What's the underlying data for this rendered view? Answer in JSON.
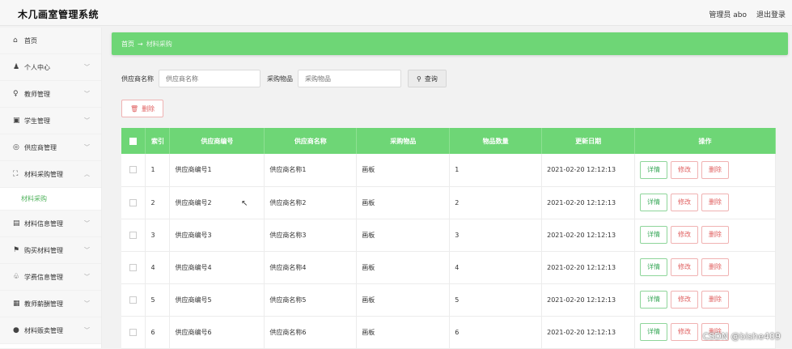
{
  "app": {
    "title": "木几画室管理系统"
  },
  "topbar": {
    "user": "管理员 abo",
    "logout": "退出登录"
  },
  "sidebar": {
    "items": [
      {
        "icon": "home-icon",
        "glyph": "⌂",
        "label": "首页",
        "chevron": false
      },
      {
        "icon": "user-icon",
        "glyph": "♟",
        "label": "个人中心",
        "chevron": true
      },
      {
        "icon": "teacher-icon",
        "glyph": "♀",
        "label": "教师管理",
        "chevron": true
      },
      {
        "icon": "student-icon",
        "glyph": "▣",
        "label": "学生管理",
        "chevron": true
      },
      {
        "icon": "supplier-icon",
        "glyph": "◎",
        "label": "供应商管理",
        "chevron": true
      },
      {
        "icon": "purchase-icon",
        "glyph": "⛶",
        "label": "材料采购管理",
        "chevron": true,
        "expanded": true
      },
      {
        "icon": "material-info-icon",
        "glyph": "▤",
        "label": "材料信息管理",
        "chevron": true
      },
      {
        "icon": "flag-icon",
        "glyph": "⚑",
        "label": "购买材料管理",
        "chevron": true
      },
      {
        "icon": "fee-icon",
        "glyph": "♧",
        "label": "学费信息管理",
        "chevron": true
      },
      {
        "icon": "salary-icon",
        "glyph": "▦",
        "label": "教师薪酬管理",
        "chevron": true
      },
      {
        "icon": "sale-icon",
        "glyph": "●",
        "label": "材料贩卖管理",
        "chevron": true
      }
    ],
    "sub_item": "材料采购"
  },
  "breadcrumb": {
    "home": "首页",
    "arrow": "→",
    "current": "材料采购"
  },
  "filters": {
    "supplier_label": "供应商名称",
    "supplier_placeholder": "供应商名称",
    "item_label": "采购物品",
    "item_placeholder": "采购物品",
    "query_label": "查询"
  },
  "toolbar": {
    "delete_label": "删除"
  },
  "table": {
    "headers": [
      "索引",
      "供应商编号",
      "供应商名称",
      "采购物品",
      "物品数量",
      "更新日期",
      "操作"
    ],
    "rows": [
      {
        "index": "1",
        "supplier_no": "供应商编号1",
        "supplier_name": "供应商名称1",
        "item": "画板",
        "qty": "1",
        "date": "2021-02-20 12:12:13"
      },
      {
        "index": "2",
        "supplier_no": "供应商编号2",
        "supplier_name": "供应商名称2",
        "item": "画板",
        "qty": "2",
        "date": "2021-02-20 12:12:13"
      },
      {
        "index": "3",
        "supplier_no": "供应商编号3",
        "supplier_name": "供应商名称3",
        "item": "画板",
        "qty": "3",
        "date": "2021-02-20 12:12:13"
      },
      {
        "index": "4",
        "supplier_no": "供应商编号4",
        "supplier_name": "供应商名称4",
        "item": "画板",
        "qty": "4",
        "date": "2021-02-20 12:12:13"
      },
      {
        "index": "5",
        "supplier_no": "供应商编号5",
        "supplier_name": "供应商名称5",
        "item": "画板",
        "qty": "5",
        "date": "2021-02-20 12:12:13"
      },
      {
        "index": "6",
        "supplier_no": "供应商编号6",
        "supplier_name": "供应商名称6",
        "item": "画板",
        "qty": "6",
        "date": "2021-02-20 12:12:13"
      }
    ],
    "actions": {
      "detail": "详情",
      "edit": "修改",
      "delete": "删除"
    }
  },
  "watermark": "CSDN @bishe409",
  "colors": {
    "accent": "#6ed676",
    "danger": "#e06060",
    "success": "#3aa85a"
  }
}
